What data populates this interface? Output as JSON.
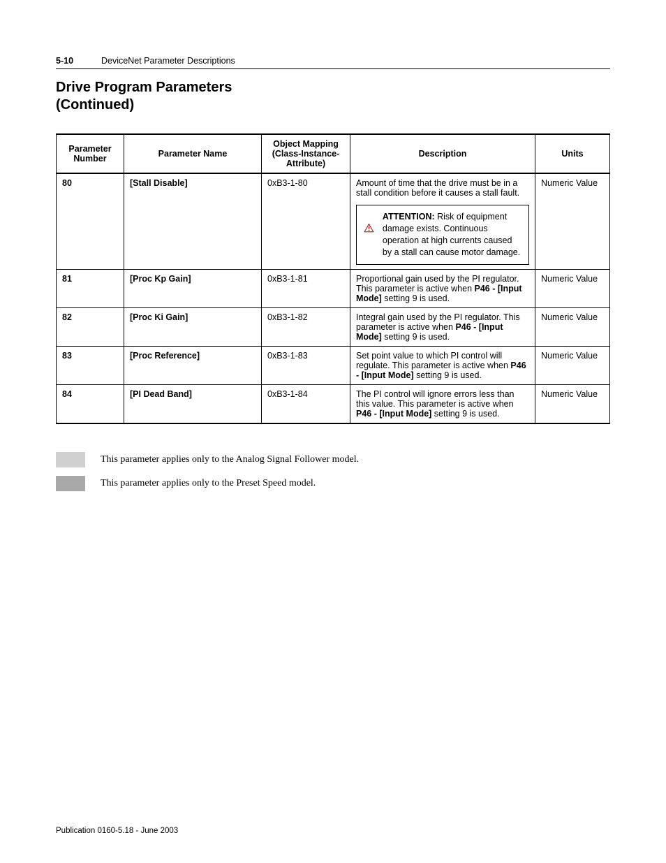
{
  "header": {
    "page_number": "5-10",
    "running_title": "DeviceNet Parameter Descriptions"
  },
  "section_title_line1": "Drive Program Parameters",
  "section_title_line2": "(Continued)",
  "table": {
    "headers": {
      "number": "Parameter Number",
      "name": "Parameter Name",
      "mapping_l1": "Object Mapping",
      "mapping_l2": "(Class-Instance-",
      "mapping_l3": "Attribute)",
      "description": "Description",
      "units": "Units"
    },
    "rows": [
      {
        "number": "80",
        "name": "[Stall Disable]",
        "mapping": "0xB3-1-80",
        "desc_intro": "Amount of time that the drive must be in a stall condition before it causes a stall fault.",
        "attention_label": "ATTENTION:",
        "attention_text": " Risk of equipment damage exists. Continuous operation at high currents caused by a stall can cause motor damage.",
        "units": "Numeric Value"
      },
      {
        "number": "81",
        "name": "[Proc Kp Gain]",
        "mapping": "0xB3-1-81",
        "desc_pre": "Proportional gain used by the PI regulator. This parameter is active when ",
        "desc_bold": "P46 - [Input Mode]",
        "desc_post": " setting 9 is used.",
        "units": "Numeric Value"
      },
      {
        "number": "82",
        "name": "[Proc Ki Gain]",
        "mapping": "0xB3-1-82",
        "desc_pre": "Integral gain used by the PI regulator. This parameter is active when ",
        "desc_bold": "P46 - [Input Mode]",
        "desc_post": " setting 9 is used.",
        "units": "Numeric Value"
      },
      {
        "number": "83",
        "name": "[Proc Reference]",
        "mapping": "0xB3-1-83",
        "desc_pre": "Set point value to which PI control will regulate. This parameter is active when ",
        "desc_bold": "P46 - [Input Mode]",
        "desc_post": " setting 9 is used.",
        "units": "Numeric Value"
      },
      {
        "number": "84",
        "name": "[PI Dead Band]",
        "mapping": "0xB3-1-84",
        "desc_pre": "The PI control will ignore errors less than this value. This parameter is active when ",
        "desc_bold": "P46 - [Input Mode]",
        "desc_post": " setting 9 is used.",
        "units": "Numeric Value"
      }
    ]
  },
  "legend": {
    "light": "This parameter applies only to the Analog Signal Follower model.",
    "dark": "This parameter applies only to the Preset Speed model."
  },
  "footer": "Publication 0160-5.18 - June 2003"
}
